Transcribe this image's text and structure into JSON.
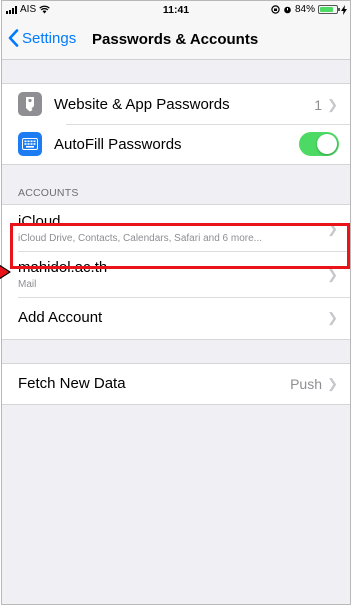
{
  "status_bar": {
    "carrier": "AIS",
    "time": "11:41",
    "battery": "84%",
    "battery_level": 0.84
  },
  "nav": {
    "back_label": "Settings",
    "title": "Passwords & Accounts"
  },
  "passwords": {
    "website_app": {
      "label": "Website & App Passwords",
      "count": "1"
    },
    "autofill": {
      "label": "AutoFill Passwords",
      "enabled": true
    }
  },
  "accounts": {
    "header": "ACCOUNTS",
    "items": [
      {
        "name": "iCloud",
        "detail": "iCloud Drive, Contacts, Calendars, Safari and 6 more..."
      },
      {
        "name": "mahidol.ac.th",
        "detail": "Mail"
      }
    ],
    "add_label": "Add Account"
  },
  "fetch": {
    "label": "Fetch New Data",
    "value": "Push"
  },
  "colors": {
    "accent": "#007aff",
    "toggle_on": "#4cd964",
    "highlight": "#e8141a"
  }
}
